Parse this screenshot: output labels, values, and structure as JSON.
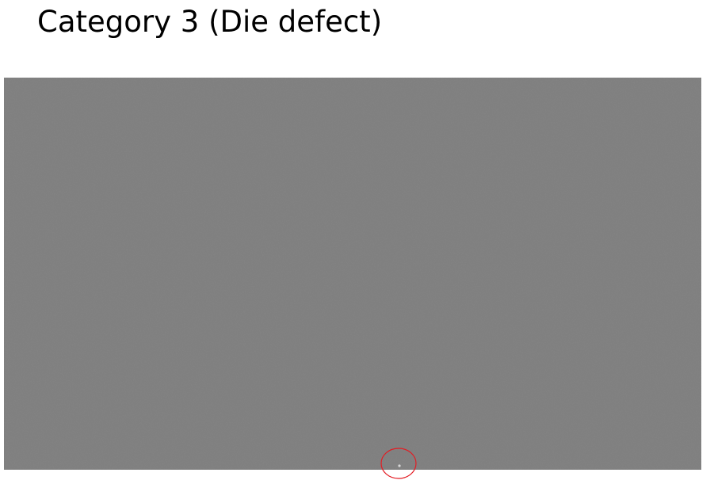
{
  "slide": {
    "title": "Category 3 (Die defect)"
  },
  "image": {
    "description_type": "grayscale inspection image",
    "background_color": "#7f7f7f",
    "defect_dot_color": "#d9d9d9"
  },
  "annotation": {
    "shape": "ellipse",
    "stroke_color": "#e31c23"
  }
}
